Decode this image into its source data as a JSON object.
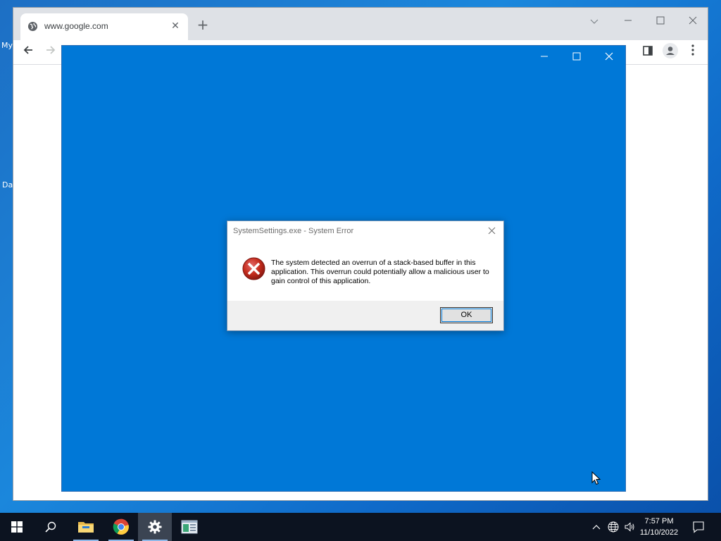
{
  "desktop": {
    "icon_label_fragments": [
      "My",
      "Da"
    ]
  },
  "browser": {
    "tab": {
      "title": "www.google.com",
      "favicon": "globe-icon"
    },
    "icons": {
      "new_tab": "plus-icon",
      "back": "arrow-left-icon",
      "forward": "arrow-right-icon",
      "side_panel": "side-panel-icon",
      "profile": "profile-icon",
      "menu": "kebab-menu-icon"
    }
  },
  "settings_window": {
    "background_color": "#0078d7"
  },
  "error_dialog": {
    "title": "SystemSettings.exe - System Error",
    "message": "The system detected an overrun of a stack-based buffer in this application. This overrun could potentially allow a malicious user to gain control of this application.",
    "ok_label": "OK",
    "icon": "error-icon"
  },
  "taskbar": {
    "items": [
      "windows-start-icon",
      "search-icon",
      "file-explorer-icon",
      "chrome-icon",
      "settings-gear-icon",
      "app-window-icon"
    ],
    "clock_time": "7:57 PM",
    "clock_date": "11/10/2022"
  },
  "colors": {
    "accent_blue": "#0078d7",
    "taskbar_bg": "#0c1320",
    "error_red": "#c42b1c"
  }
}
